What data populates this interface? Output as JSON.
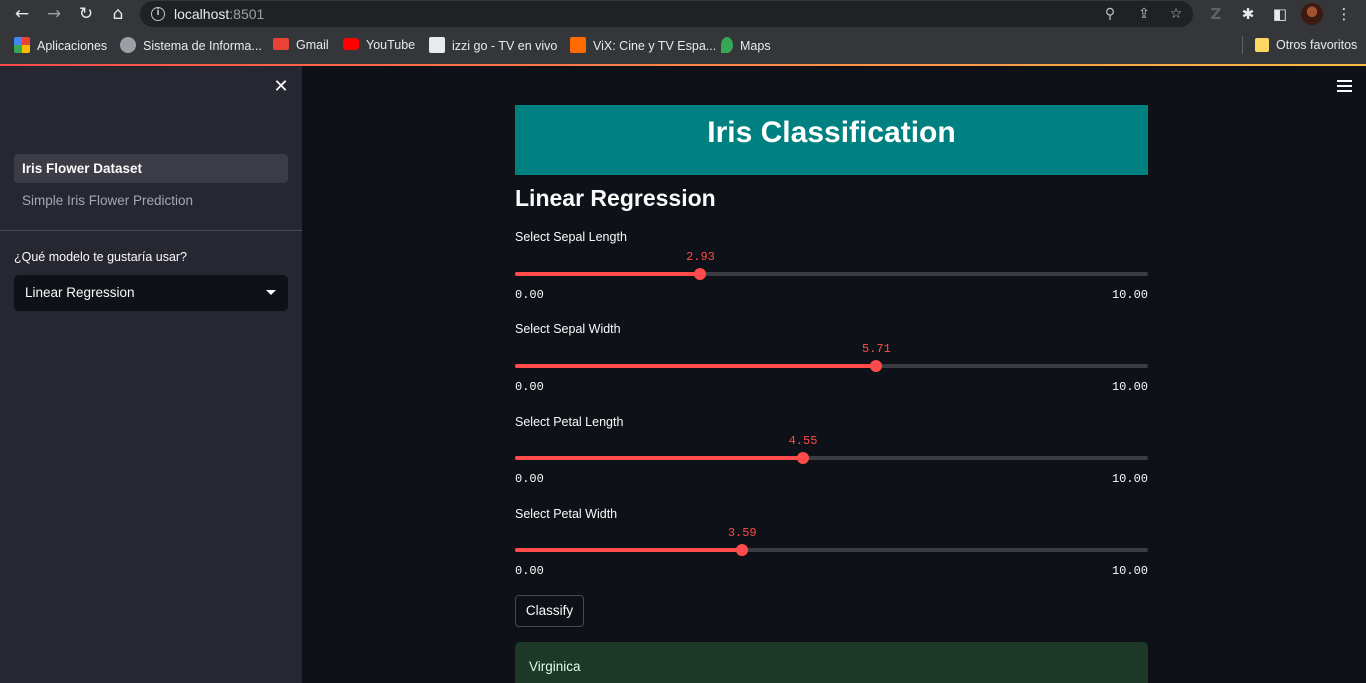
{
  "browser": {
    "url_host": "localhost",
    "url_port": ":8501",
    "bookmarks": [
      {
        "label": "Aplicaciones",
        "color": "#4285f4"
      },
      {
        "label": "Sistema de Informa...",
        "color": "#9aa0a6"
      },
      {
        "label": "Gmail",
        "color": "#ea4335"
      },
      {
        "label": "YouTube",
        "color": "#ff0000"
      },
      {
        "label": "izzi go - TV en vivo",
        "color": "#e8eaed"
      },
      {
        "label": "ViX: Cine y TV Espa...",
        "color": "#ff6a00"
      },
      {
        "label": "Maps",
        "color": "#34a853"
      }
    ],
    "other_bookmarks": "Otros favoritos"
  },
  "sidebar": {
    "nav": [
      {
        "label": "Iris Flower Dataset",
        "active": true
      },
      {
        "label": "Simple Iris Flower Prediction",
        "active": false
      }
    ],
    "model_label": "¿Qué modelo te gustaría usar?",
    "model_value": "Linear Regression"
  },
  "main": {
    "title": "Iris Classification",
    "title_bg": "#008080",
    "subheader": "Linear Regression",
    "sliders": [
      {
        "label": "Select Sepal Length",
        "value": "2.93",
        "fraction": 0.293,
        "min": "0.00",
        "max": "10.00"
      },
      {
        "label": "Select Sepal Width",
        "value": "5.71",
        "fraction": 0.571,
        "min": "0.00",
        "max": "10.00"
      },
      {
        "label": "Select Petal Length",
        "value": "4.55",
        "fraction": 0.455,
        "min": "0.00",
        "max": "10.00"
      },
      {
        "label": "Select Petal Width",
        "value": "3.59",
        "fraction": 0.359,
        "min": "0.00",
        "max": "10.00"
      }
    ],
    "button_label": "Classify",
    "result": "Virginica"
  },
  "colors": {
    "accent": "#ff4b4b",
    "success_bg": "#1c3829"
  }
}
